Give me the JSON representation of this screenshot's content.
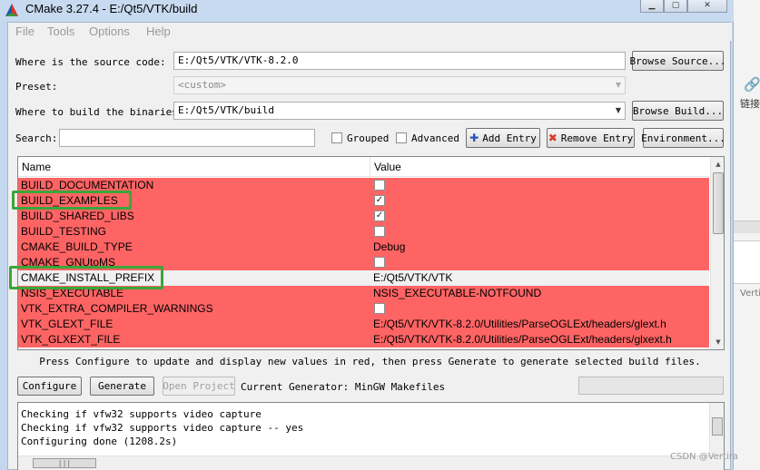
{
  "window": {
    "title": "CMake 3.27.4 - E:/Qt5/VTK/build"
  },
  "background_app": {
    "icon_glyph": "🔗",
    "label": "链接",
    "partial_text": "Vertira"
  },
  "menu": {
    "items": [
      "File",
      "Tools",
      "Options",
      "Help"
    ]
  },
  "source": {
    "label": "Where is the source code:",
    "value": "E:/Qt5/VTK/VTK-8.2.0",
    "button": "Browse Source..."
  },
  "preset": {
    "label": "Preset:",
    "value": "<custom>"
  },
  "binaries": {
    "label": "Where to build the binaries:",
    "value": "E:/Qt5/VTK/build",
    "button": "Browse Build..."
  },
  "search": {
    "label": "Search:",
    "value": ""
  },
  "options": {
    "grouped": {
      "label": "Grouped",
      "checked": false
    },
    "advanced": {
      "label": "Advanced",
      "checked": false
    }
  },
  "actions": {
    "add_entry": "Add Entry",
    "remove_entry": "Remove Entry",
    "environment": "Environment..."
  },
  "table": {
    "headers": {
      "name": "Name",
      "value": "Value"
    },
    "rows": [
      {
        "name": "BUILD_DOCUMENTATION",
        "type": "bool",
        "value": "",
        "checked": false,
        "state": "new"
      },
      {
        "name": "BUILD_EXAMPLES",
        "type": "bool",
        "value": "",
        "checked": true,
        "state": "new",
        "highlighted": true
      },
      {
        "name": "BUILD_SHARED_LIBS",
        "type": "bool",
        "value": "",
        "checked": true,
        "state": "new"
      },
      {
        "name": "BUILD_TESTING",
        "type": "bool",
        "value": "",
        "checked": false,
        "state": "new"
      },
      {
        "name": "CMAKE_BUILD_TYPE",
        "type": "text",
        "value": "Debug",
        "state": "new"
      },
      {
        "name": "CMAKE_GNUtoMS",
        "type": "bool",
        "value": "",
        "checked": false,
        "state": "new"
      },
      {
        "name": "CMAKE_INSTALL_PREFIX",
        "type": "text",
        "value": "E:/Qt5/VTK/VTK",
        "state": "selected",
        "highlighted": true
      },
      {
        "name": "NSIS_EXECUTABLE",
        "type": "text",
        "value": "NSIS_EXECUTABLE-NOTFOUND",
        "state": "new"
      },
      {
        "name": "VTK_EXTRA_COMPILER_WARNINGS",
        "type": "bool",
        "value": "",
        "checked": false,
        "state": "new"
      },
      {
        "name": "VTK_GLEXT_FILE",
        "type": "text",
        "value": "E:/Qt5/VTK/VTK-8.2.0/Utilities/ParseOGLExt/headers/glext.h",
        "state": "new"
      },
      {
        "name": "VTK_GLXEXT_FILE",
        "type": "text",
        "value": "E:/Qt5/VTK/VTK-8.2.0/Utilities/ParseOGLExt/headers/glxext.h",
        "state": "new"
      }
    ]
  },
  "notice": "Press Configure to update and display new values in red, then press Generate to generate selected build files.",
  "bottom": {
    "configure": "Configure",
    "generate": "Generate",
    "open_project": "Open Project",
    "generator_label": "Current Generator: MinGW Makefiles"
  },
  "output": {
    "lines": [
      "Checking if vfw32 supports video capture",
      "Checking if vfw32 supports video capture -- yes",
      "Configuring done (1208.2s)"
    ]
  },
  "watermark": "CSDN @Vertira",
  "colors": {
    "new_entry_red": "#ff6464",
    "highlight_green": "#3aa63a",
    "title_bar": "#c7daef"
  }
}
